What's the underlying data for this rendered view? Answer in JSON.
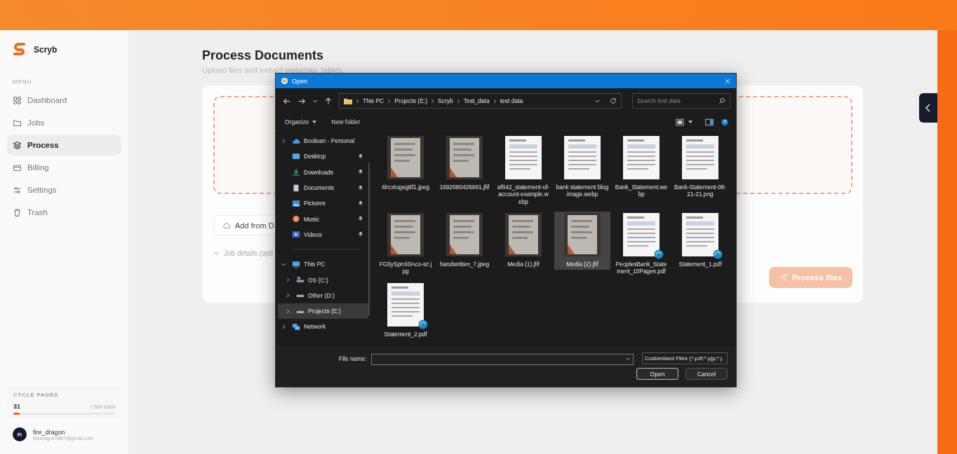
{
  "sidebar": {
    "brand": "Scryb",
    "menu_label": "MENU",
    "items": [
      {
        "label": "Dashboard",
        "kind": "grid",
        "selected": false
      },
      {
        "label": "Jobs",
        "kind": "folder",
        "selected": false
      },
      {
        "label": "Process",
        "kind": "layers",
        "selected": true
      },
      {
        "label": "Billing",
        "kind": "card",
        "selected": false
      },
      {
        "label": "Settings",
        "kind": "sliders",
        "selected": false
      },
      {
        "label": "Trash",
        "kind": "trash",
        "selected": false
      }
    ],
    "usage": {
      "label": "CYCLE PAGES",
      "count": "31",
      "limit": "/ 500 used",
      "level": 0.062
    },
    "user": {
      "initials": "FI",
      "name": "fire_dragon",
      "email": "firedragon.fd67@gmail.com"
    }
  },
  "main": {
    "title": "Process Documents",
    "subtitle": "Upload files and extract metadata, tables,",
    "add_button": "Add from D",
    "job_details": "Job details (opti",
    "process_button": "Process files"
  },
  "dialog": {
    "title": "Open",
    "path": [
      "This PC",
      "Projects (E:)",
      "Scryb",
      "Test_data",
      "test data"
    ],
    "search": {
      "placeholder": "Search test data"
    },
    "commands": [
      "Organize",
      "New folder"
    ],
    "nav": [
      {
        "label": "Boolean - Personal",
        "kind": "cloud",
        "expanded": false,
        "selected": false
      },
      {
        "label": "Desktop",
        "kind": "desktop",
        "pinned": true,
        "selected": false
      },
      {
        "label": "Downloads",
        "kind": "download",
        "pinned": true,
        "selected": false
      },
      {
        "label": "Documents",
        "kind": "documents",
        "pinned": true,
        "selected": false
      },
      {
        "label": "Pictures",
        "kind": "pictures",
        "pinned": true,
        "selected": false
      },
      {
        "label": "Music",
        "kind": "music",
        "pinned": true,
        "selected": false
      },
      {
        "label": "Videos",
        "kind": "videos",
        "pinned": true,
        "selected": false
      },
      {
        "label": "This PC",
        "kind": "pc",
        "expanded": true,
        "selected": false,
        "children": [
          {
            "label": "OS (C:)",
            "kind": "osdrive",
            "expanded": false,
            "selected": false
          },
          {
            "label": "Other (D:)",
            "kind": "drive",
            "expanded": false,
            "selected": false
          },
          {
            "label": "Projects (E:)",
            "kind": "drive",
            "expanded": false,
            "selected": true
          }
        ]
      },
      {
        "label": "Network",
        "kind": "network",
        "expanded": false,
        "selected": false
      }
    ],
    "files": [
      {
        "name": "4lrcxtogeg6f1.jpeg",
        "selected": false,
        "app_badge": false
      },
      {
        "name": "1692080426991.jfif",
        "selected": false,
        "app_badge": false
      },
      {
        "name": "af642_statement-of-account-example.webp",
        "selected": false,
        "app_badge": false
      },
      {
        "name": "bank statement blog image.webp",
        "selected": false,
        "app_badge": false
      },
      {
        "name": "Bank_Statement.webp",
        "selected": false,
        "app_badge": false
      },
      {
        "name": "Bank-Statement-08-21-21.png",
        "selected": false,
        "app_badge": false
      },
      {
        "name": "FG5ySpnX0Aco-sz.jpg",
        "selected": false,
        "app_badge": false
      },
      {
        "name": "handwritten_7.jpeg",
        "selected": false,
        "app_badge": false
      },
      {
        "name": "Media (1).jfif",
        "selected": false,
        "app_badge": false
      },
      {
        "name": "Media (2).jfif",
        "selected": true,
        "app_badge": false
      },
      {
        "name": "PeoplesBank_Statement_10Pages.pdf",
        "selected": false,
        "app_badge": true
      },
      {
        "name": "Statement_1.pdf",
        "selected": false,
        "app_badge": true
      },
      {
        "name": "Statement_2.pdf",
        "selected": false,
        "app_badge": true
      }
    ],
    "file_name_label": "File name:",
    "filter": "Customised Files (*.pdf;*.pjp;*.j",
    "buttons": [
      "Open",
      "Cancel"
    ]
  }
}
